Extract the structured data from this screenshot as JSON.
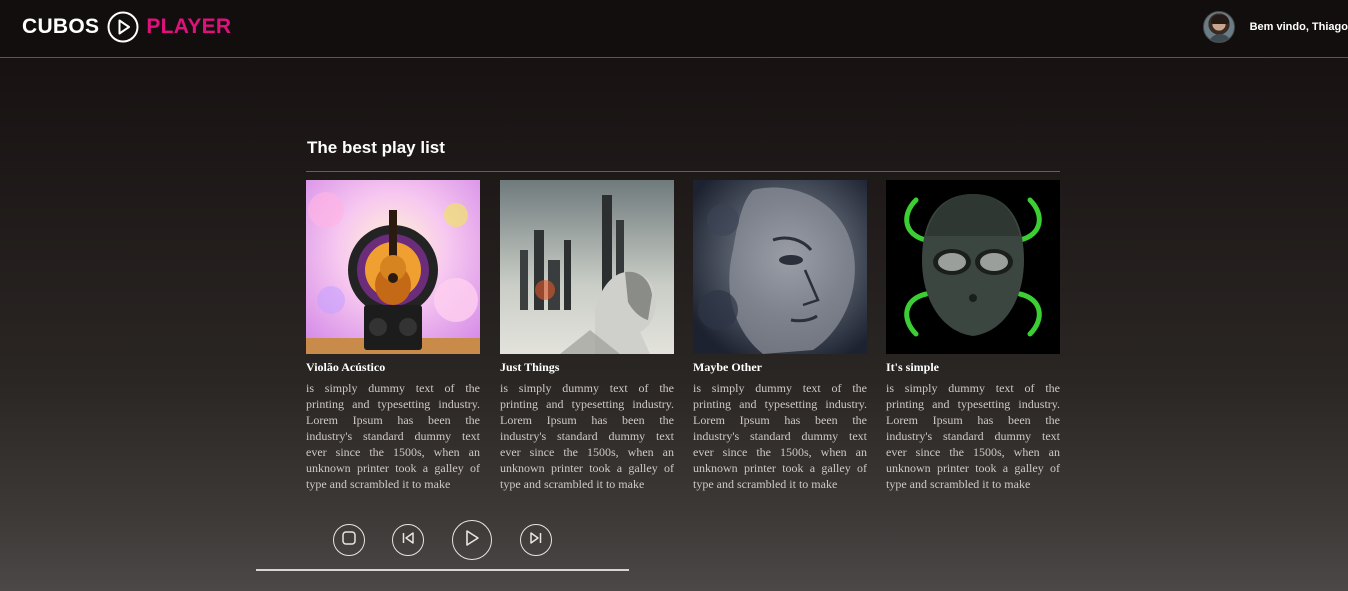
{
  "header": {
    "logo_left": "CUBOS",
    "logo_right": "PLAYER",
    "welcome": "Bem vindo, Thiago"
  },
  "colors": {
    "brand_pink": "#e0107d",
    "text_white": "#ffffff",
    "text_muted": "#cfc9c7"
  },
  "section": {
    "title": "The best play list"
  },
  "playlists": [
    {
      "title": "Violão Acústico",
      "description": "is simply dummy text of the printing and typesetting industry. Lorem Ipsum has been the industry's standard dummy text ever since the 1500s, when an unknown printer took a galley of type and scrambled it to make",
      "cover_icon": "acoustic-guitar-cover"
    },
    {
      "title": "Just Things",
      "description": "is simply dummy text of the printing and typesetting industry. Lorem Ipsum has been the industry's standard dummy text ever since the 1500s, when an unknown printer took a galley of type and scrambled it to make",
      "cover_icon": "city-woman-cover"
    },
    {
      "title": "Maybe Other",
      "description": "is simply dummy text of the printing and typesetting industry. Lorem Ipsum has been the industry's standard dummy text ever since the 1500s, when an unknown printer took a galley of type and scrambled it to make",
      "cover_icon": "textured-face-cover"
    },
    {
      "title": "It's simple",
      "description": "is simply dummy text of the printing and typesetting industry. Lorem Ipsum has been the industry's standard dummy text ever since the 1500s, when an unknown printer took a galley of type and scrambled it to make",
      "cover_icon": "mask-cover"
    }
  ],
  "player": {
    "controls": [
      "stop-icon",
      "previous-icon",
      "play-icon",
      "next-icon"
    ],
    "progress": 0
  }
}
